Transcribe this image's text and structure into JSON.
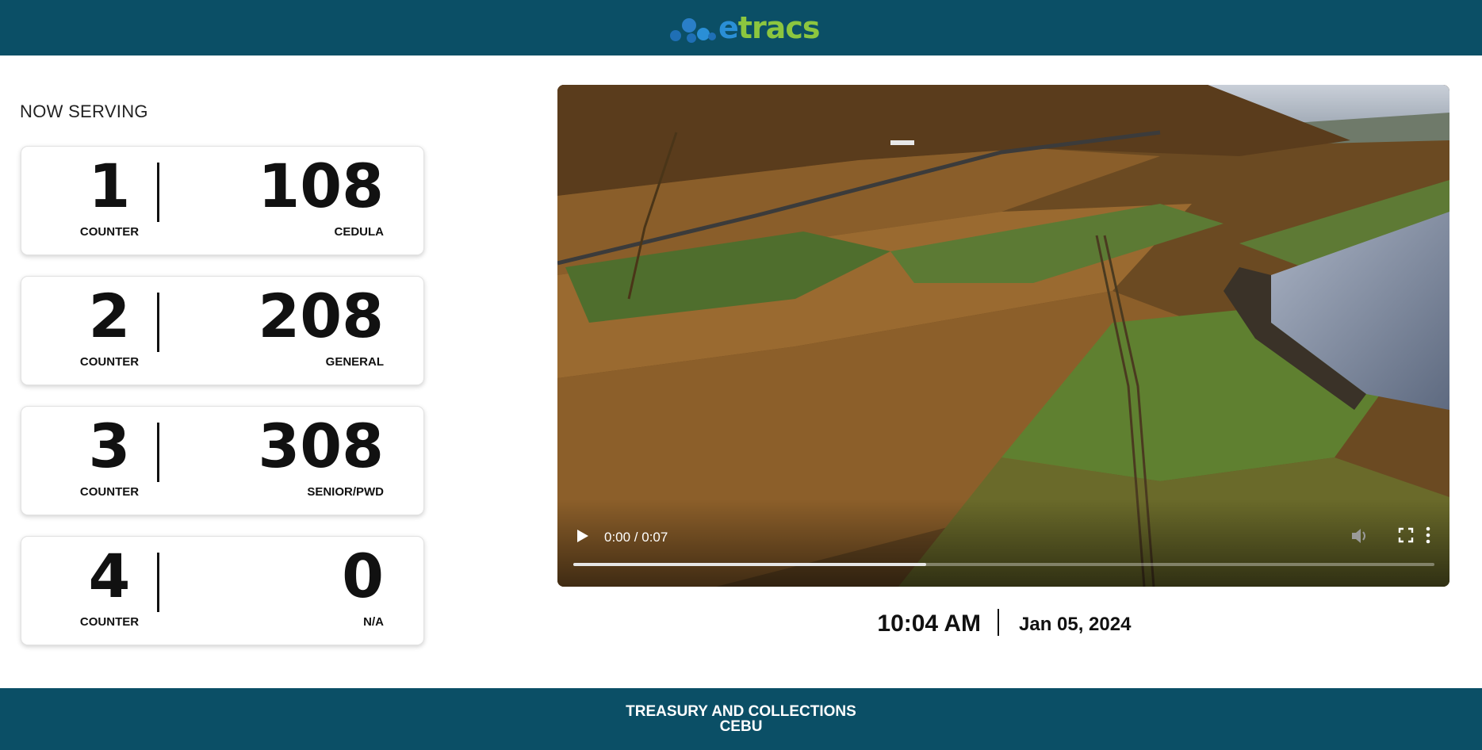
{
  "header": {
    "logo": {
      "prefix": "e",
      "suffix": "tracs",
      "icon": "bubbles-logo-icon"
    }
  },
  "serving": {
    "title": "NOW SERVING",
    "counters": [
      {
        "counter": "1",
        "counter_label": "COUNTER",
        "ticket": "108",
        "service": "CEDULA"
      },
      {
        "counter": "2",
        "counter_label": "COUNTER",
        "ticket": "208",
        "service": "GENERAL"
      },
      {
        "counter": "3",
        "counter_label": "COUNTER",
        "ticket": "308",
        "service": "SENIOR/PWD"
      },
      {
        "counter": "4",
        "counter_label": "COUNTER",
        "ticket": "0",
        "service": "N/A"
      }
    ]
  },
  "video": {
    "time_display": "0:00 / 0:07",
    "progress": 0.41,
    "icons": [
      "play-icon",
      "volume-icon",
      "fullscreen-icon",
      "more-vert-icon"
    ]
  },
  "clock": {
    "time": "10:04 AM",
    "date": "Jan 05, 2024"
  },
  "footer": {
    "line1": "TREASURY AND COLLECTIONS",
    "line2": "CEBU"
  },
  "colors": {
    "bar": "#0b4f66",
    "logo_blue": "#2a8fd6",
    "logo_green": "#8cc63f"
  }
}
